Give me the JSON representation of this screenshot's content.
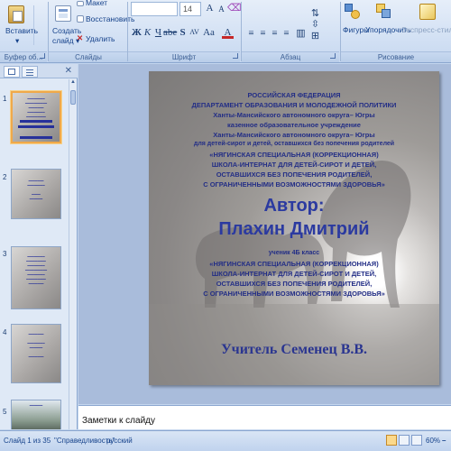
{
  "ribbon": {
    "clipboard": {
      "paste_label": "Вставить",
      "group_label": "Буфер об..."
    },
    "slides": {
      "create_label": "Создать",
      "create_sub": "слайд ▾",
      "layout_label": "Макет",
      "reset_label": "Восстановить",
      "delete_label": "Удалить",
      "group_label": "Слайды"
    },
    "font": {
      "size_value": "14",
      "group_label": "Шрифт"
    },
    "paragraph": {
      "group_label": "Абзац"
    },
    "drawing": {
      "shapes_label": "Фигуры",
      "arrange_label": "Упорядочить",
      "styles_label": "Экспресс-стили",
      "group_label": "Рисование"
    }
  },
  "left_panel": {
    "thumbnails": [
      {
        "number": "1"
      },
      {
        "number": "2"
      },
      {
        "number": "3"
      },
      {
        "number": "4"
      },
      {
        "number": "5"
      }
    ]
  },
  "slide": {
    "header_lines": [
      "РОССИЙСКАЯ ФЕДЕРАЦИЯ",
      "ДЕПАРТАМЕНТ ОБРАЗОВАНИЯ И МОЛОДЕЖНОЙ ПОЛИТИКИ",
      "Ханты-Мансийского автономного округа– Югры",
      "казенное образовательное учреждение",
      "Ханты-Мансийского автономного округа– Югры",
      "для детей-сирот и детей, оставшихся без попечения родителей",
      "«НЯГИНСКАЯ СПЕЦИАЛЬНАЯ (КОРРЕКЦИОННАЯ)",
      "ШКОЛА-ИНТЕРНАТ ДЛЯ ДЕТЕЙ-СИРОТ И ДЕТЕЙ,",
      "ОСТАВШИХСЯ БЕЗ ПОПЕЧЕНИЯ РОДИТЕЛЕЙ,",
      "С ОГРАНИЧЕННЫМИ ВОЗМОЖНОСТЯМИ ЗДОРОВЬЯ»"
    ],
    "author_label": "Автор:",
    "author_name": "Плахин Дмитрий",
    "student_lines": [
      "ученик 4Б класс",
      "«НЯГИНСКАЯ СПЕЦИАЛЬНАЯ (КОРРЕКЦИОННАЯ)",
      "ШКОЛА-ИНТЕРНАТ ДЛЯ ДЕТЕЙ-СИРОТ И ДЕТЕЙ,",
      "ОСТАВШИХСЯ БЕЗ ПОПЕЧЕНИЯ РОДИТЕЛЕЙ,",
      "С ОГРАНИЧЕННЫМИ ВОЗМОЖНОСТЯМИ ЗДОРОВЬЯ»"
    ],
    "teacher": "Учитель Семенец В.В.",
    "text_color": "#232e86"
  },
  "notes": {
    "placeholder": "Заметки к слайду"
  },
  "status_bar": {
    "slide_info": "Слайд 1 из 35",
    "theme": "\"Справедливость\"",
    "language": "русский",
    "zoom": "60%"
  }
}
